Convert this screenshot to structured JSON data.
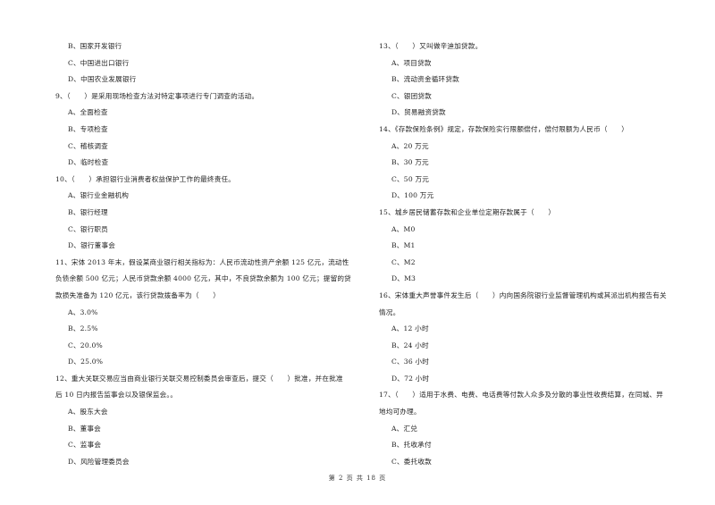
{
  "left_column": [
    {
      "type": "option",
      "text": "B、国家开发银行"
    },
    {
      "type": "option",
      "text": "C、中国进出口银行"
    },
    {
      "type": "option",
      "text": "D、中国农业发展银行"
    },
    {
      "type": "question",
      "text": "9、（　　）是采用现场检查方法对特定事项进行专门调查的活动。"
    },
    {
      "type": "option",
      "text": "A、全面检查"
    },
    {
      "type": "option",
      "text": "B、专项检查"
    },
    {
      "type": "option",
      "text": "C、稽核调查"
    },
    {
      "type": "option",
      "text": "D、临时检查"
    },
    {
      "type": "question",
      "text": "10、（　　）承担银行业消费者权益保护工作的最终责任。"
    },
    {
      "type": "option",
      "text": "A、银行业金融机构"
    },
    {
      "type": "option",
      "text": "B、银行经理"
    },
    {
      "type": "option",
      "text": "C、银行职员"
    },
    {
      "type": "option",
      "text": "D、银行董事会"
    },
    {
      "type": "question",
      "text": "11、宋体 2013 年末，假设某商业银行相关指标为：人民币流动性资产余额 125 亿元，流动性"
    },
    {
      "type": "question",
      "text": "负债余额 500 亿元；人民币贷款余额 4000 亿元，其中，不良贷款余额为 100 亿元；提留的贷"
    },
    {
      "type": "question",
      "text": "款损失准备为 120 亿元，该行贷款拨备率为（　　）"
    },
    {
      "type": "option",
      "text": "A、3.0%"
    },
    {
      "type": "option",
      "text": "B、2.5%"
    },
    {
      "type": "option",
      "text": "C、20.0%"
    },
    {
      "type": "option",
      "text": "D、25.0%"
    },
    {
      "type": "question",
      "text": "12、重大关联交易应当由商业银行关联交易控制委员会审查后，提交（　　）批准，并在批准"
    },
    {
      "type": "question",
      "text": "后 10 日内报告监事会以及银保监会。。"
    },
    {
      "type": "option",
      "text": "A、股东大会"
    },
    {
      "type": "option",
      "text": "B、董事会"
    },
    {
      "type": "option",
      "text": "C、监事会"
    },
    {
      "type": "option",
      "text": "D、风险管理委员会"
    }
  ],
  "right_column": [
    {
      "type": "question",
      "text": "13、（　　）又叫做辛迪加贷款。"
    },
    {
      "type": "option",
      "text": "A、项目贷款"
    },
    {
      "type": "option",
      "text": "B、流动资金循环贷款"
    },
    {
      "type": "option",
      "text": "C、银团贷款"
    },
    {
      "type": "option",
      "text": "D、贸易融资贷款"
    },
    {
      "type": "question",
      "text": "14、《存款保险条例》规定，存款保险实行限额偿付，偿付限额为人民币（　　）"
    },
    {
      "type": "option",
      "text": "A、20 万元"
    },
    {
      "type": "option",
      "text": "B、30 万元"
    },
    {
      "type": "option",
      "text": "C、50 万元"
    },
    {
      "type": "option",
      "text": "D、100 万元"
    },
    {
      "type": "question",
      "text": "15、城乡居民储蓄存款和企业单位定期存款属于（　　）"
    },
    {
      "type": "option",
      "text": "A、M0"
    },
    {
      "type": "option",
      "text": "B、M1"
    },
    {
      "type": "option",
      "text": "C、M2"
    },
    {
      "type": "option",
      "text": "D、M3"
    },
    {
      "type": "question",
      "text": "16、宋体重大声誉事件发生后（　　）内向国务院银行业监督管理机构或其派出机构报告有关"
    },
    {
      "type": "question",
      "text": "情况。"
    },
    {
      "type": "option",
      "text": "A、12 小时"
    },
    {
      "type": "option",
      "text": "B、24 小时"
    },
    {
      "type": "option",
      "text": "C、36 小时"
    },
    {
      "type": "option",
      "text": "D、72 小时"
    },
    {
      "type": "question",
      "text": "17、（　　）适用于水费、电费、电话费等付款人众多及分散的事业性收费结算，在同城、异"
    },
    {
      "type": "question",
      "text": "地均可办理。"
    },
    {
      "type": "option",
      "text": "A、汇兑"
    },
    {
      "type": "option",
      "text": "B、托收承付"
    },
    {
      "type": "option",
      "text": "C、委托收款"
    }
  ],
  "footer": {
    "text": "第 2 页 共 18 页"
  }
}
